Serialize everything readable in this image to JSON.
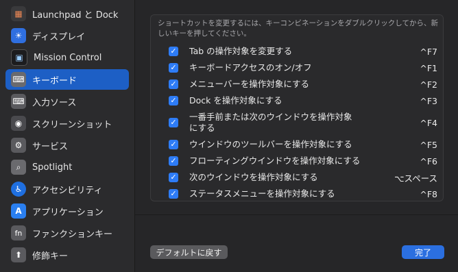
{
  "sidebar": {
    "items": [
      {
        "label": "Launchpad と Dock",
        "icon": "launchpad-icon",
        "glyph": "▦",
        "color": "#3a3a3c"
      },
      {
        "label": "ディスプレイ",
        "icon": "display-icon",
        "glyph": "☀",
        "color": "#2f6fe0"
      },
      {
        "label": "Mission Control",
        "icon": "mission-control-icon",
        "glyph": "▣",
        "color": "#1c1c1e"
      },
      {
        "label": "キーボード",
        "icon": "keyboard-icon",
        "glyph": "⌨",
        "color": "#5a5a5e"
      },
      {
        "label": "入力ソース",
        "icon": "input-sources-icon",
        "glyph": "⌨",
        "color": "#5a5a5e"
      },
      {
        "label": "スクリーンショット",
        "icon": "screenshot-icon",
        "glyph": "◉",
        "color": "#4a4a4e"
      },
      {
        "label": "サービス",
        "icon": "services-icon",
        "glyph": "⚙",
        "color": "#5a5a5e"
      },
      {
        "label": "Spotlight",
        "icon": "spotlight-icon",
        "glyph": "⌕",
        "color": "#6a6a6e"
      },
      {
        "label": "アクセシビリティ",
        "icon": "accessibility-icon",
        "glyph": "♿",
        "color": "#1f6fe0"
      },
      {
        "label": "アプリケーション",
        "icon": "app-shortcuts-icon",
        "glyph": "A",
        "color": "#2a7ff0"
      },
      {
        "label": "ファンクションキー",
        "icon": "function-keys-icon",
        "glyph": "fn",
        "color": "#5a5a5e"
      },
      {
        "label": "修飾キー",
        "icon": "modifier-keys-icon",
        "glyph": "⬆",
        "color": "#5a5a5e"
      }
    ],
    "selected_index": 3
  },
  "panel": {
    "description": "ショートカットを変更するには、キーコンビネーションをダブルクリックしてから、新しいキーを押してください。",
    "rows": [
      {
        "label": "Tab の操作対象を変更する",
        "key": "^F7",
        "checked": true
      },
      {
        "label": "キーボードアクセスのオン/オフ",
        "key": "^F1",
        "checked": true
      },
      {
        "label": "メニューバーを操作対象にする",
        "key": "^F2",
        "checked": true
      },
      {
        "label": "Dock を操作対象にする",
        "key": "^F3",
        "checked": true
      },
      {
        "label": "一番手前または次のウインドウを操作対象にする",
        "key": "^F4",
        "checked": true
      },
      {
        "label": "ウインドウのツールバーを操作対象にする",
        "key": "^F5",
        "checked": true
      },
      {
        "label": "フローティングウインドウを操作対象にする",
        "key": "^F6",
        "checked": true
      },
      {
        "label": "次のウインドウを操作対象にする",
        "key": "⌥スペース",
        "checked": true
      },
      {
        "label": "ステータスメニューを操作対象にする",
        "key": "^F8",
        "checked": true
      }
    ]
  },
  "buttons": {
    "default_label": "デフォルトに戻す",
    "done_label": "完了"
  },
  "colors": {
    "accent": "#2b6fe0",
    "selected": "#1d5fc5",
    "checkbox": "#2e7cf6"
  }
}
